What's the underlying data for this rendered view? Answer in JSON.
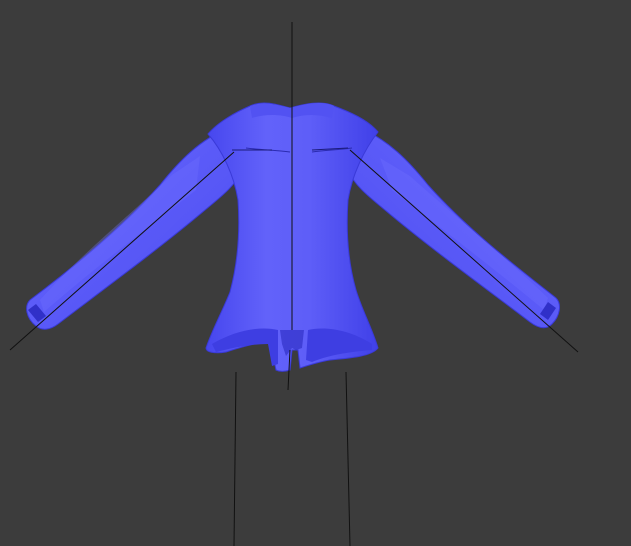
{
  "viewport": {
    "background_color": "#3c3c3c"
  },
  "model": {
    "garment_type_icon": "jacket-mesh",
    "fill_color": "#5a5af7",
    "shade_color": "#3c3ce6",
    "highlight_color": "#8080ff",
    "skeleton_line_color": "#111111"
  }
}
